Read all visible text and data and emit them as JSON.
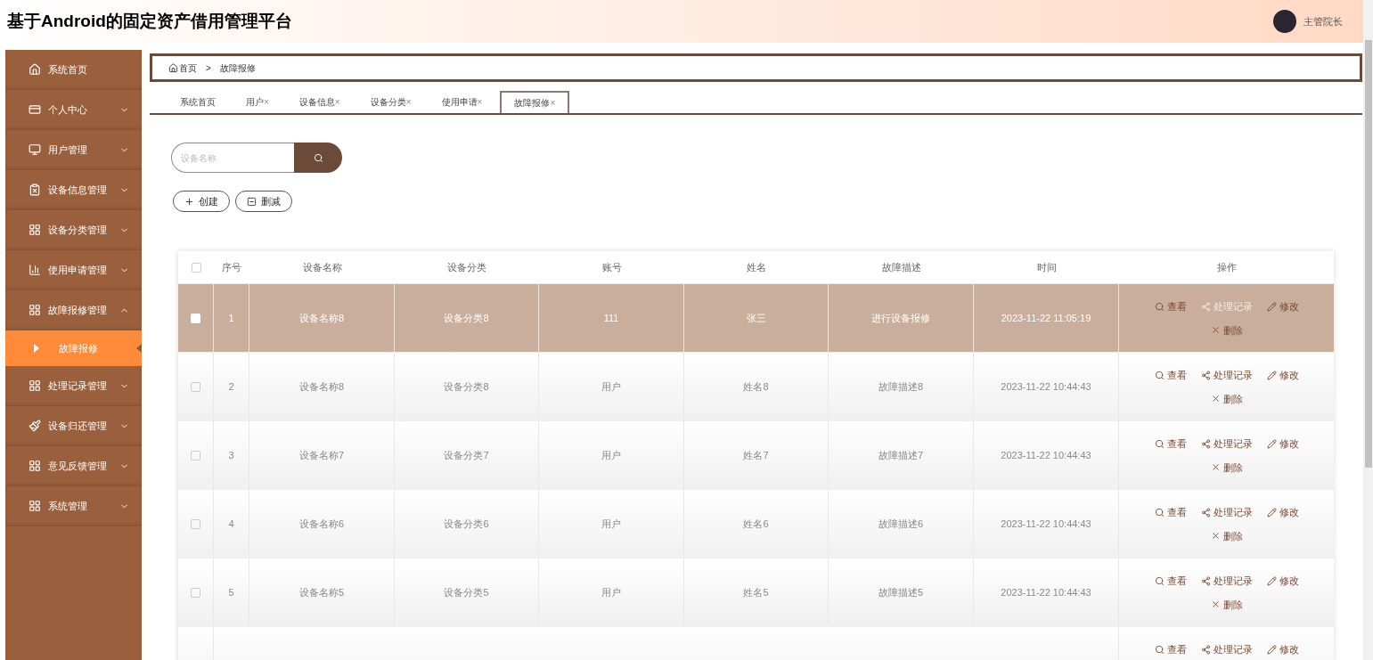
{
  "header": {
    "title": "基于Android的固定资产借用管理平台",
    "user": "主管院长"
  },
  "sidebar": {
    "items": [
      {
        "label": "系统首页",
        "kind": "home"
      },
      {
        "label": "个人中心",
        "kind": "card",
        "expanded": false
      },
      {
        "label": "用户管理",
        "kind": "monitor",
        "expanded": false
      },
      {
        "label": "设备信息管理",
        "kind": "clipboard",
        "expanded": false
      },
      {
        "label": "设备分类管理",
        "kind": "grid",
        "expanded": false
      },
      {
        "label": "使用申请管理",
        "kind": "bars",
        "expanded": false
      },
      {
        "label": "故障报修管理",
        "kind": "grid",
        "expanded": true,
        "children": [
          {
            "label": "故障报修",
            "selected": true
          }
        ]
      },
      {
        "label": "处理记录管理",
        "kind": "grid",
        "expanded": false
      },
      {
        "label": "设备归还管理",
        "kind": "brush",
        "expanded": false
      },
      {
        "label": "意见反馈管理",
        "kind": "grid",
        "expanded": false
      },
      {
        "label": "系统管理",
        "kind": "grid",
        "expanded": false
      }
    ]
  },
  "breadcrumb": [
    "首页",
    "故障报修"
  ],
  "breadcrumb_separator": ">",
  "tabs": [
    {
      "label": "系统首页",
      "selected": false
    },
    {
      "label": "用户",
      "close": "×",
      "selected": false
    },
    {
      "label": "设备信息",
      "close": "×",
      "selected": false
    },
    {
      "label": "设备分类",
      "close": "×",
      "selected": false
    },
    {
      "label": "使用申请",
      "close": "×",
      "selected": false
    },
    {
      "label": "故障报修",
      "close": "×",
      "selected": true
    }
  ],
  "search": {
    "placeholder": "设备名称"
  },
  "toolbar": [
    {
      "kind": "create",
      "label": "创建"
    },
    {
      "kind": "delete",
      "label": "删减"
    }
  ],
  "table": {
    "select_all": false,
    "columns": [
      "序号",
      "设备名称",
      "设备分类",
      "账号",
      "姓名",
      "故障描述",
      "时间",
      "操作"
    ],
    "rows": [
      {
        "selected": true,
        "cells": [
          "1",
          "设备名称8",
          "设备分类8",
          "111",
          "张三",
          "进行设备报修",
          "2023-11-22 11:05:19"
        ],
        "actions": [
          {
            "kind": "view",
            "label": "查看",
            "disabled": false
          },
          {
            "kind": "records",
            "label": "处理记录",
            "disabled": true
          },
          {
            "kind": "edit",
            "label": "修改",
            "disabled": false
          },
          {
            "kind": "delete",
            "label": "删除",
            "disabled": false
          }
        ]
      },
      {
        "selected": false,
        "cells": [
          "2",
          "设备名称8",
          "设备分类8",
          "用户",
          "姓名8",
          "故障描述8",
          "2023-11-22 10:44:43"
        ],
        "actions": [
          {
            "kind": "view",
            "label": "查看",
            "disabled": false
          },
          {
            "kind": "records",
            "label": "处理记录",
            "disabled": false
          },
          {
            "kind": "edit",
            "label": "修改",
            "disabled": false
          },
          {
            "kind": "delete",
            "label": "删除",
            "disabled": false
          }
        ]
      },
      {
        "selected": false,
        "cells": [
          "3",
          "设备名称7",
          "设备分类7",
          "用户",
          "姓名7",
          "故障描述7",
          "2023-11-22 10:44:43"
        ],
        "actions": [
          {
            "kind": "view",
            "label": "查看",
            "disabled": false
          },
          {
            "kind": "records",
            "label": "处理记录",
            "disabled": false
          },
          {
            "kind": "edit",
            "label": "修改",
            "disabled": false
          },
          {
            "kind": "delete",
            "label": "删除",
            "disabled": false
          }
        ]
      },
      {
        "selected": false,
        "cells": [
          "4",
          "设备名称6",
          "设备分类6",
          "用户",
          "姓名6",
          "故障描述6",
          "2023-11-22 10:44:43"
        ],
        "actions": [
          {
            "kind": "view",
            "label": "查看",
            "disabled": false
          },
          {
            "kind": "records",
            "label": "处理记录",
            "disabled": false
          },
          {
            "kind": "edit",
            "label": "修改",
            "disabled": false
          },
          {
            "kind": "delete",
            "label": "删除",
            "disabled": false
          }
        ]
      },
      {
        "selected": false,
        "cells": [
          "5",
          "设备名称5",
          "设备分类5",
          "用户",
          "姓名5",
          "故障描述5",
          "2023-11-22 10:44:43"
        ],
        "actions": [
          {
            "kind": "view",
            "label": "查看",
            "disabled": false
          },
          {
            "kind": "records",
            "label": "处理记录",
            "disabled": false
          },
          {
            "kind": "edit",
            "label": "修改",
            "disabled": false
          },
          {
            "kind": "delete",
            "label": "删除",
            "disabled": false
          }
        ]
      },
      {
        "selected": false,
        "actions": [
          {
            "kind": "view",
            "label": "查看",
            "disabled": false
          },
          {
            "kind": "records",
            "label": "处理记录",
            "disabled": false
          },
          {
            "kind": "edit",
            "label": "修改",
            "disabled": false
          }
        ]
      }
    ]
  }
}
